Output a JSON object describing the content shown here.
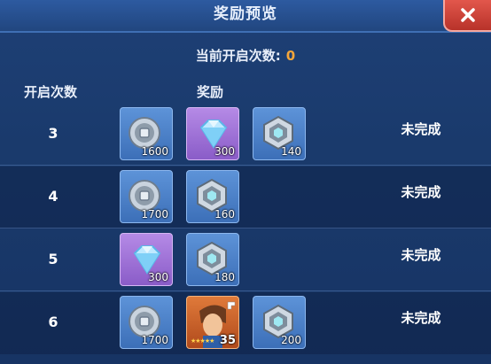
{
  "window": {
    "title": "奖励预览"
  },
  "summary": {
    "label": "当前开启次数:",
    "value": "0"
  },
  "columns": {
    "count": "开启次数",
    "reward": "奖励"
  },
  "rows": [
    {
      "count": "3",
      "status": "未完成",
      "rewards": [
        {
          "icon": "silver-coin-icon",
          "qty": "1600"
        },
        {
          "icon": "diamond-icon",
          "qty": "300"
        },
        {
          "icon": "silver-badge-icon",
          "qty": "140"
        }
      ]
    },
    {
      "count": "4",
      "status": "未完成",
      "rewards": [
        {
          "icon": "silver-coin-icon",
          "qty": "1700"
        },
        {
          "icon": "silver-badge-icon",
          "qty": "160"
        }
      ]
    },
    {
      "count": "5",
      "status": "未完成",
      "rewards": [
        {
          "icon": "diamond-icon",
          "qty": "300"
        },
        {
          "icon": "silver-badge-icon",
          "qty": "180"
        }
      ]
    },
    {
      "count": "6",
      "status": "未完成",
      "rewards": [
        {
          "icon": "silver-coin-icon",
          "qty": "1700"
        },
        {
          "icon": "hero-shard-icon",
          "qty": "35"
        },
        {
          "icon": "silver-badge-icon",
          "qty": "200"
        }
      ]
    }
  ],
  "colors": {
    "accent": "#f5a63a",
    "close": "#d4453b",
    "panel": "#1b3a6b"
  }
}
